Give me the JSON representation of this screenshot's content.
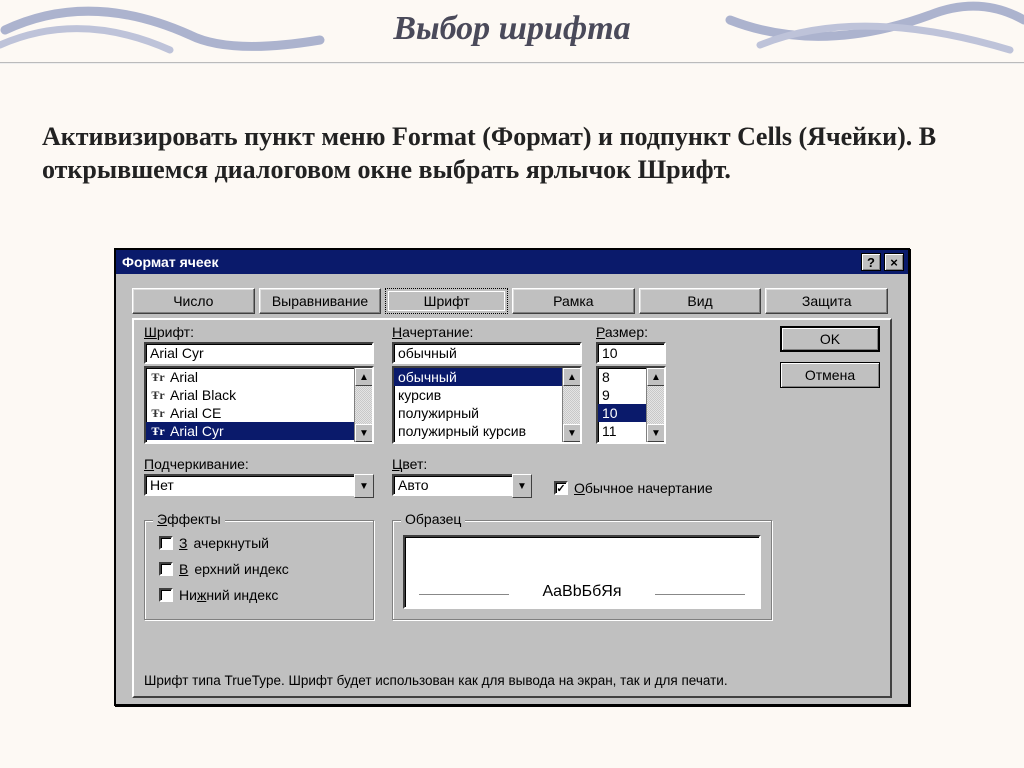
{
  "slide": {
    "title": "Выбор шрифта",
    "body": "Активизировать пункт меню Format (Формат) и подпункт Cells (Ячейки). В открывшемся диалоговом окне выбрать ярлычок Шрифт."
  },
  "dialog": {
    "title": "Формат ячеек",
    "help_glyph": "?",
    "close_glyph": "×",
    "tabs": [
      "Число",
      "Выравнивание",
      "Шрифт",
      "Рамка",
      "Вид",
      "Защита"
    ],
    "active_tab_index": 2,
    "buttons": {
      "ok": "OK",
      "cancel": "Отмена"
    },
    "font": {
      "label": "Шрифт:",
      "value": "Arial Cyr",
      "list": [
        "Arial",
        "Arial Black",
        "Arial CE",
        "Arial Cyr"
      ],
      "selected_index": 3
    },
    "style": {
      "label": "Начертание:",
      "value": "обычный",
      "list": [
        "обычный",
        "курсив",
        "полужирный",
        "полужирный курсив"
      ],
      "selected_index": 0
    },
    "size": {
      "label": "Размер:",
      "value": "10",
      "list": [
        "8",
        "9",
        "10",
        "11"
      ],
      "selected_index": 2
    },
    "underline": {
      "label": "Подчеркивание:",
      "value": "Нет"
    },
    "color": {
      "label": "Цвет:",
      "value": "Авто"
    },
    "normal_font_checkbox": {
      "label": "Обычное начертание",
      "checked": true,
      "mark": "✓"
    },
    "effects": {
      "legend": "Эффекты",
      "strike": "Зачеркнутый",
      "super": "Верхний индекс",
      "sub": "Нижний индекс"
    },
    "preview": {
      "legend": "Образец",
      "sample": "AaBbБбЯя"
    },
    "footer": "Шрифт типа TrueType. Шрифт будет использован как для вывода на экран, так и для печати."
  }
}
